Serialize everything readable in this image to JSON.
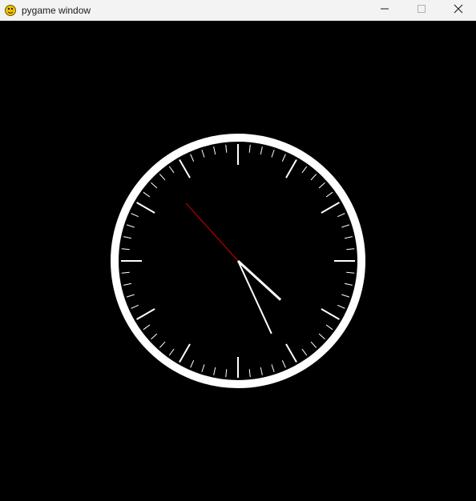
{
  "window": {
    "title": "pygame window",
    "controls": {
      "minimize_icon": "minimize-icon",
      "maximize_icon": "maximize-icon",
      "close_icon": "close-icon"
    },
    "app_icon": "pygame-snake-icon"
  },
  "clock": {
    "time": {
      "hour": 4,
      "minute": 25,
      "second": 53
    },
    "colors": {
      "background": "#000000",
      "face_ring": "#ffffff",
      "ticks": "#ffffff",
      "hour_hand": "#ffffff",
      "minute_hand": "#ffffff",
      "second_hand": "#d40000"
    }
  }
}
